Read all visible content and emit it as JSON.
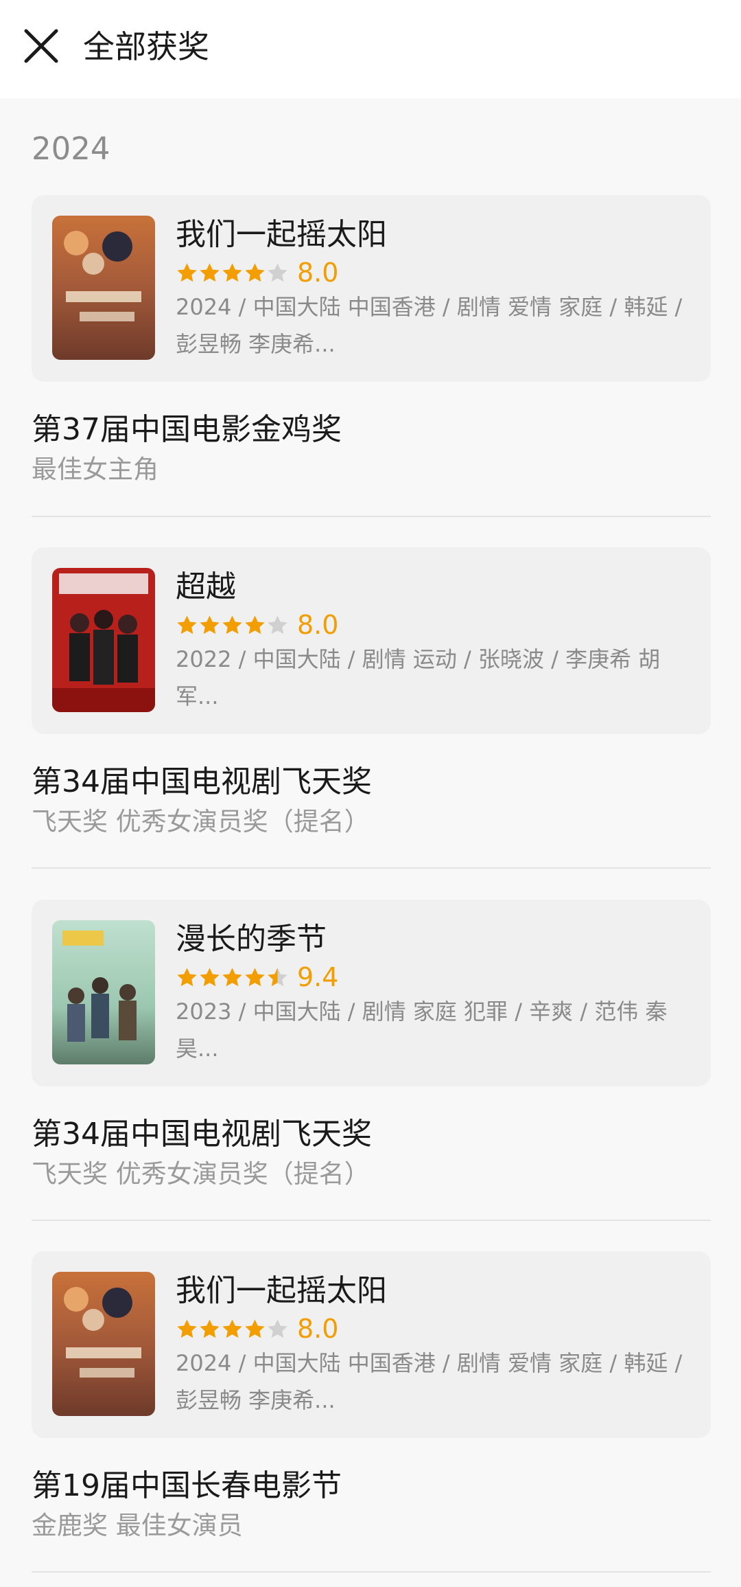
{
  "header": {
    "title": "全部获奖"
  },
  "year": "2024",
  "colors": {
    "accent": "#f29d00",
    "star_off": "#d0d0d0"
  },
  "icons": {
    "close": "close-icon",
    "star": "star-icon"
  },
  "entries": [
    {
      "movie": {
        "title": "我们一起摇太阳",
        "rating": 4,
        "score": "8.0",
        "meta": "2024 / 中国大陆 中国香港 / 剧情 爱情 家庭 / 韩延 / 彭昱畅 李庚希..."
      },
      "award": {
        "name": "第37届中国电影金鸡奖",
        "detail": "最佳女主角"
      }
    },
    {
      "movie": {
        "title": "超越",
        "rating": 4,
        "score": "8.0",
        "meta": "2022 / 中国大陆 / 剧情 运动 / 张晓波 / 李庚希 胡军..."
      },
      "award": {
        "name": "第34届中国电视剧飞天奖",
        "detail": "飞天奖 优秀女演员奖（提名）"
      }
    },
    {
      "movie": {
        "title": "漫长的季节",
        "rating": 4.5,
        "score": "9.4",
        "meta": "2023 / 中国大陆 / 剧情 家庭 犯罪 / 辛爽 / 范伟 秦昊..."
      },
      "award": {
        "name": "第34届中国电视剧飞天奖",
        "detail": "飞天奖 优秀女演员奖（提名）"
      }
    },
    {
      "movie": {
        "title": "我们一起摇太阳",
        "rating": 4,
        "score": "8.0",
        "meta": "2024 / 中国大陆 中国香港 / 剧情 爱情 家庭 / 韩延 / 彭昱畅 李庚希..."
      },
      "award": {
        "name": "第19届中国长春电影节",
        "detail": "金鹿奖 最佳女演员"
      }
    }
  ]
}
